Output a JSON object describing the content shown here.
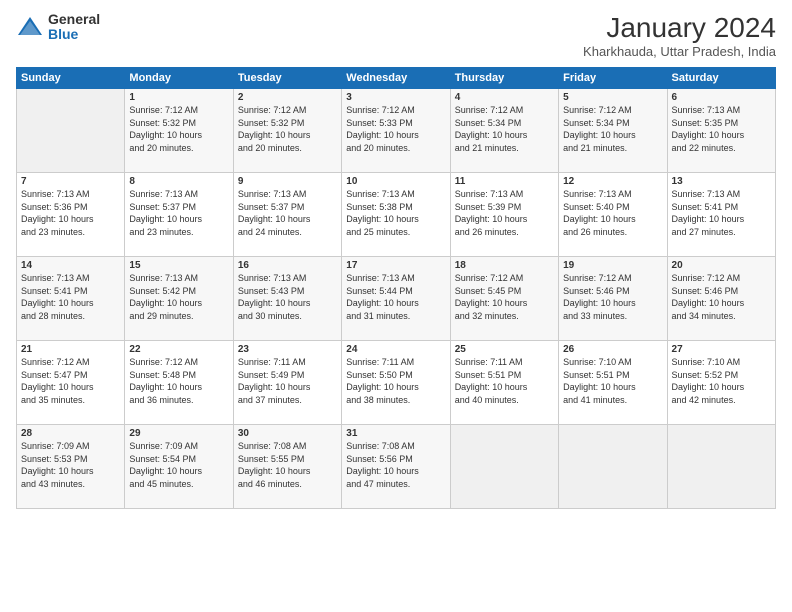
{
  "logo": {
    "general": "General",
    "blue": "Blue"
  },
  "title": "January 2024",
  "subtitle": "Kharkhauda, Uttar Pradesh, India",
  "days_of_week": [
    "Sunday",
    "Monday",
    "Tuesday",
    "Wednesday",
    "Thursday",
    "Friday",
    "Saturday"
  ],
  "weeks": [
    [
      {
        "day": "",
        "info": ""
      },
      {
        "day": "1",
        "info": "Sunrise: 7:12 AM\nSunset: 5:32 PM\nDaylight: 10 hours\nand 20 minutes."
      },
      {
        "day": "2",
        "info": "Sunrise: 7:12 AM\nSunset: 5:32 PM\nDaylight: 10 hours\nand 20 minutes."
      },
      {
        "day": "3",
        "info": "Sunrise: 7:12 AM\nSunset: 5:33 PM\nDaylight: 10 hours\nand 20 minutes."
      },
      {
        "day": "4",
        "info": "Sunrise: 7:12 AM\nSunset: 5:34 PM\nDaylight: 10 hours\nand 21 minutes."
      },
      {
        "day": "5",
        "info": "Sunrise: 7:12 AM\nSunset: 5:34 PM\nDaylight: 10 hours\nand 21 minutes."
      },
      {
        "day": "6",
        "info": "Sunrise: 7:13 AM\nSunset: 5:35 PM\nDaylight: 10 hours\nand 22 minutes."
      }
    ],
    [
      {
        "day": "7",
        "info": "Sunrise: 7:13 AM\nSunset: 5:36 PM\nDaylight: 10 hours\nand 23 minutes."
      },
      {
        "day": "8",
        "info": "Sunrise: 7:13 AM\nSunset: 5:37 PM\nDaylight: 10 hours\nand 23 minutes."
      },
      {
        "day": "9",
        "info": "Sunrise: 7:13 AM\nSunset: 5:37 PM\nDaylight: 10 hours\nand 24 minutes."
      },
      {
        "day": "10",
        "info": "Sunrise: 7:13 AM\nSunset: 5:38 PM\nDaylight: 10 hours\nand 25 minutes."
      },
      {
        "day": "11",
        "info": "Sunrise: 7:13 AM\nSunset: 5:39 PM\nDaylight: 10 hours\nand 26 minutes."
      },
      {
        "day": "12",
        "info": "Sunrise: 7:13 AM\nSunset: 5:40 PM\nDaylight: 10 hours\nand 26 minutes."
      },
      {
        "day": "13",
        "info": "Sunrise: 7:13 AM\nSunset: 5:41 PM\nDaylight: 10 hours\nand 27 minutes."
      }
    ],
    [
      {
        "day": "14",
        "info": "Sunrise: 7:13 AM\nSunset: 5:41 PM\nDaylight: 10 hours\nand 28 minutes."
      },
      {
        "day": "15",
        "info": "Sunrise: 7:13 AM\nSunset: 5:42 PM\nDaylight: 10 hours\nand 29 minutes."
      },
      {
        "day": "16",
        "info": "Sunrise: 7:13 AM\nSunset: 5:43 PM\nDaylight: 10 hours\nand 30 minutes."
      },
      {
        "day": "17",
        "info": "Sunrise: 7:13 AM\nSunset: 5:44 PM\nDaylight: 10 hours\nand 31 minutes."
      },
      {
        "day": "18",
        "info": "Sunrise: 7:12 AM\nSunset: 5:45 PM\nDaylight: 10 hours\nand 32 minutes."
      },
      {
        "day": "19",
        "info": "Sunrise: 7:12 AM\nSunset: 5:46 PM\nDaylight: 10 hours\nand 33 minutes."
      },
      {
        "day": "20",
        "info": "Sunrise: 7:12 AM\nSunset: 5:46 PM\nDaylight: 10 hours\nand 34 minutes."
      }
    ],
    [
      {
        "day": "21",
        "info": "Sunrise: 7:12 AM\nSunset: 5:47 PM\nDaylight: 10 hours\nand 35 minutes."
      },
      {
        "day": "22",
        "info": "Sunrise: 7:12 AM\nSunset: 5:48 PM\nDaylight: 10 hours\nand 36 minutes."
      },
      {
        "day": "23",
        "info": "Sunrise: 7:11 AM\nSunset: 5:49 PM\nDaylight: 10 hours\nand 37 minutes."
      },
      {
        "day": "24",
        "info": "Sunrise: 7:11 AM\nSunset: 5:50 PM\nDaylight: 10 hours\nand 38 minutes."
      },
      {
        "day": "25",
        "info": "Sunrise: 7:11 AM\nSunset: 5:51 PM\nDaylight: 10 hours\nand 40 minutes."
      },
      {
        "day": "26",
        "info": "Sunrise: 7:10 AM\nSunset: 5:51 PM\nDaylight: 10 hours\nand 41 minutes."
      },
      {
        "day": "27",
        "info": "Sunrise: 7:10 AM\nSunset: 5:52 PM\nDaylight: 10 hours\nand 42 minutes."
      }
    ],
    [
      {
        "day": "28",
        "info": "Sunrise: 7:09 AM\nSunset: 5:53 PM\nDaylight: 10 hours\nand 43 minutes."
      },
      {
        "day": "29",
        "info": "Sunrise: 7:09 AM\nSunset: 5:54 PM\nDaylight: 10 hours\nand 45 minutes."
      },
      {
        "day": "30",
        "info": "Sunrise: 7:08 AM\nSunset: 5:55 PM\nDaylight: 10 hours\nand 46 minutes."
      },
      {
        "day": "31",
        "info": "Sunrise: 7:08 AM\nSunset: 5:56 PM\nDaylight: 10 hours\nand 47 minutes."
      },
      {
        "day": "",
        "info": ""
      },
      {
        "day": "",
        "info": ""
      },
      {
        "day": "",
        "info": ""
      }
    ]
  ]
}
